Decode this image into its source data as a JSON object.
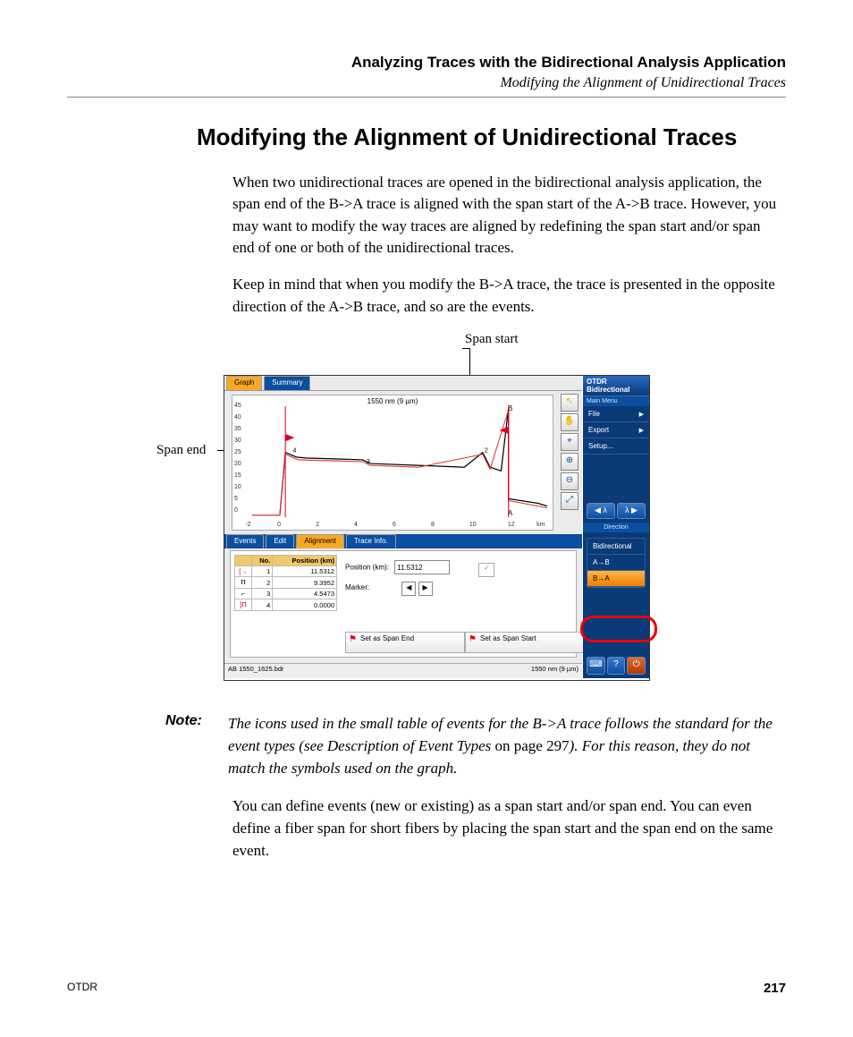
{
  "header": {
    "title": "Analyzing Traces with the Bidirectional Analysis Application",
    "subtitle": "Modifying the Alignment of Unidirectional Traces"
  },
  "h1": "Modifying the Alignment of Unidirectional Traces",
  "paragraphs": {
    "p1": "When two unidirectional traces are opened in the bidirectional analysis application, the span end of the B->A trace is aligned with the span start of the A->B trace. However, you may want to modify the way traces are aligned by redefining the span start and/or span end of one or both of the unidirectional traces.",
    "p2": "Keep in mind that when you modify the B->A trace, the trace is presented in the opposite direction of the A->B trace, and so are the events.",
    "p3": "You can define events (new or existing) as a span start and/or span end. You can even define a fiber span for short fibers by placing the span start and the span end on the same event."
  },
  "note": {
    "label": "Note:",
    "italic1": "The icons used in the small table of events for the B->A trace follows the standard for the event types (see Description of Event Types",
    "plain": " on page 297",
    "italic2": "). For this reason, they do not match the symbols used on the graph."
  },
  "callouts": {
    "span_start": "Span start",
    "span_end": "Span end"
  },
  "app": {
    "tabs_top": {
      "graph": "Graph",
      "summary": "Summary"
    },
    "graph": {
      "title": "1550 nm (9 µm)",
      "y_ticks": [
        "45",
        "40",
        "35",
        "30",
        "25",
        "20",
        "15",
        "10",
        "5",
        "0"
      ],
      "x_ticks": [
        "-2",
        "0",
        "2",
        "4",
        "6",
        "8",
        "10",
        "12",
        "km"
      ],
      "x_ticks_pos": [
        4,
        14,
        26,
        38,
        50,
        62,
        74,
        86,
        95
      ],
      "mark_a": "A",
      "mark_b": "B"
    },
    "toolbar": [
      "↖",
      "✋",
      "⌖",
      "⊕",
      "⊖",
      "⤢"
    ],
    "tabs_bot": {
      "events": "Events",
      "edit": "Edit",
      "alignment": "Alignment",
      "trace": "Trace Info."
    },
    "events": {
      "col_no": "No.",
      "col_pos": "Position (km)",
      "rows": [
        {
          "icon": "[→",
          "no": "1",
          "pos": "11.5312"
        },
        {
          "icon": "Ⲡ",
          "no": "2",
          "pos": "9.3952"
        },
        {
          "icon": "⌐",
          "no": "3",
          "pos": "4.5473"
        },
        {
          "icon": "]Ⲡ",
          "no": "4",
          "pos": "0.0000"
        }
      ]
    },
    "align": {
      "position_label": "Position (km):",
      "position_value": "11.5312",
      "marker_label": "Marker:",
      "set_end": "Set as Span End",
      "set_start": "Set as Span Start"
    },
    "status": {
      "file": "AB 1550_1625.bdr",
      "wl": "1550 nm (9 µm)"
    },
    "sidebar": {
      "title": "OTDR Bidirectional",
      "menu_label": "Main Menu",
      "items": {
        "file": "File",
        "export": "Export",
        "setup": "Setup..."
      },
      "wl_prev": "◀ λ",
      "wl_next": "λ ▶",
      "direction_label": "Direction",
      "dir_bidir": "Bidirectional",
      "dir_ab": "A→B",
      "dir_ba": "B→A"
    }
  },
  "footer": {
    "product": "OTDR",
    "page": "217"
  }
}
